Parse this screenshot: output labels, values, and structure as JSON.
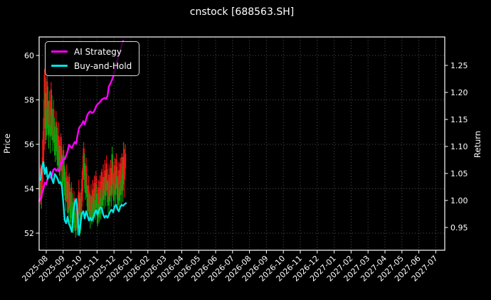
{
  "figure": {
    "title": "cnstock [688563.SH]"
  },
  "legend": {
    "items": [
      {
        "label": "AI Strategy",
        "color": "#ff00ff"
      },
      {
        "label": "Buy-and-Hold",
        "color": "#00e5e5"
      }
    ]
  },
  "axes": {
    "left": {
      "label": "Price",
      "tick_labels": [
        "60",
        "58",
        "56",
        "54",
        "52"
      ],
      "tick_values": [
        60,
        58,
        56,
        54,
        52
      ]
    },
    "right": {
      "label": "Return",
      "tick_labels": [
        "1.25",
        "1.20",
        "1.15",
        "1.10",
        "1.05",
        "1.00",
        "0.95"
      ],
      "tick_values": [
        1.25,
        1.2,
        1.15,
        1.1,
        1.05,
        1.0,
        0.95
      ]
    },
    "bottom": {
      "tick_labels": [
        "2025-08",
        "2025-09",
        "2025-10",
        "2025-11",
        "2025-12",
        "2026-01",
        "2026-02",
        "2026-03",
        "2026-04",
        "2026-05",
        "2026-06",
        "2026-07",
        "2026-08",
        "2026-09",
        "2026-10",
        "2026-11",
        "2026-12",
        "2027-01",
        "2027-02",
        "2027-03",
        "2027-04",
        "2027-05",
        "2027-06",
        "2027-07"
      ]
    }
  },
  "chart_data": {
    "type": "candlestick+line",
    "title": "cnstock [688563.SH]",
    "price_axis": {
      "label": "Price",
      "range": [
        51.2,
        60.85
      ],
      "ticks": [
        52,
        54,
        56,
        58,
        60
      ]
    },
    "return_axis": {
      "label": "Return",
      "range": [
        0.918,
        1.309
      ],
      "ticks": [
        0.95,
        1.0,
        1.05,
        1.1,
        1.15,
        1.2,
        1.25
      ]
    },
    "x_axis": {
      "tick_labels": [
        "2025-08",
        "2025-09",
        "2025-10",
        "2025-11",
        "2025-12",
        "2026-01",
        "2026-02",
        "2026-03",
        "2026-04",
        "2026-05",
        "2026-06",
        "2026-07",
        "2026-08",
        "2026-09",
        "2026-10",
        "2026-11",
        "2026-12",
        "2027-01",
        "2027-02",
        "2027-03",
        "2027-04",
        "2027-05",
        "2027-06",
        "2027-07"
      ],
      "data_span_note": "price/return data covers only 2025-07 through 2025-12; rest of axis is empty"
    },
    "colors": {
      "up_candle": "#f01616",
      "down_candle": "#0ca50c",
      "grid": "#4f4f4f",
      "spine": "#ffffff",
      "text": "#ffffff"
    },
    "candles": {
      "x_start_tick": -0.336,
      "x_step_tick": 0.04808,
      "bars_format": [
        "high",
        "low",
        "up(r)/down(g)"
      ],
      "bars": [
        [
          55.1,
          53.3,
          "r"
        ],
        [
          54.6,
          53.1,
          "g"
        ],
        [
          55.4,
          53.6,
          "r"
        ],
        [
          56.6,
          54.3,
          "r"
        ],
        [
          58.0,
          55.2,
          "r"
        ],
        [
          59.4,
          56.8,
          "r"
        ],
        [
          59.0,
          56.0,
          "g"
        ],
        [
          58.3,
          56.2,
          "g"
        ],
        [
          59.2,
          57.0,
          "r"
        ],
        [
          58.6,
          56.4,
          "g"
        ],
        [
          57.8,
          55.8,
          "g"
        ],
        [
          58.4,
          56.5,
          "r"
        ],
        [
          57.6,
          55.6,
          "g"
        ],
        [
          58.8,
          56.8,
          "r"
        ],
        [
          58.2,
          56.2,
          "g"
        ],
        [
          57.4,
          55.7,
          "g"
        ],
        [
          58.0,
          56.1,
          "r"
        ],
        [
          57.2,
          55.5,
          "g"
        ],
        [
          56.8,
          55.2,
          "g"
        ],
        [
          57.5,
          55.8,
          "r"
        ],
        [
          56.9,
          55.3,
          "g"
        ],
        [
          56.4,
          54.9,
          "g"
        ],
        [
          57.0,
          55.2,
          "r"
        ],
        [
          56.2,
          54.6,
          "g"
        ],
        [
          55.8,
          54.3,
          "g"
        ],
        [
          56.5,
          54.8,
          "r"
        ],
        [
          55.9,
          54.2,
          "g"
        ],
        [
          55.3,
          53.8,
          "g"
        ],
        [
          56.0,
          54.4,
          "r"
        ],
        [
          55.5,
          53.9,
          "g"
        ],
        [
          54.9,
          53.5,
          "g"
        ],
        [
          54.4,
          53.0,
          "g"
        ],
        [
          55.1,
          53.4,
          "r"
        ],
        [
          54.6,
          52.9,
          "g"
        ],
        [
          54.0,
          52.6,
          "g"
        ],
        [
          54.7,
          53.0,
          "r"
        ],
        [
          54.2,
          52.7,
          "g"
        ],
        [
          53.6,
          52.3,
          "g"
        ],
        [
          54.3,
          52.8,
          "r"
        ],
        [
          53.8,
          52.4,
          "g"
        ],
        [
          53.2,
          52.0,
          "g"
        ],
        [
          53.9,
          52.5,
          "r"
        ],
        [
          53.4,
          52.1,
          "g"
        ],
        [
          52.9,
          51.8,
          "g"
        ],
        [
          53.5,
          52.2,
          "r"
        ],
        [
          53.0,
          51.9,
          "g"
        ],
        [
          53.7,
          52.3,
          "r"
        ],
        [
          54.4,
          52.9,
          "r"
        ],
        [
          53.8,
          52.5,
          "g"
        ],
        [
          53.3,
          52.0,
          "g"
        ],
        [
          54.0,
          52.6,
          "r"
        ],
        [
          54.8,
          53.2,
          "r"
        ],
        [
          55.5,
          53.9,
          "r"
        ],
        [
          56.1,
          54.4,
          "r"
        ],
        [
          55.6,
          54.0,
          "g"
        ],
        [
          54.9,
          53.5,
          "g"
        ],
        [
          55.4,
          53.8,
          "r"
        ],
        [
          54.7,
          53.2,
          "g"
        ],
        [
          54.1,
          52.8,
          "g"
        ],
        [
          54.6,
          53.0,
          "r"
        ],
        [
          53.9,
          52.6,
          "g"
        ],
        [
          53.4,
          52.2,
          "g"
        ],
        [
          54.2,
          52.7,
          "r"
        ],
        [
          53.7,
          52.4,
          "g"
        ],
        [
          54.4,
          52.9,
          "r"
        ],
        [
          53.8,
          52.5,
          "g"
        ],
        [
          54.6,
          53.1,
          "r"
        ],
        [
          54.0,
          52.6,
          "g"
        ],
        [
          54.8,
          53.3,
          "r"
        ],
        [
          54.2,
          52.8,
          "g"
        ],
        [
          53.6,
          52.3,
          "g"
        ],
        [
          54.4,
          52.9,
          "r"
        ],
        [
          53.8,
          52.5,
          "g"
        ],
        [
          54.6,
          53.0,
          "r"
        ],
        [
          54.0,
          52.6,
          "g"
        ],
        [
          54.9,
          53.4,
          "r"
        ],
        [
          54.3,
          52.9,
          "g"
        ],
        [
          55.1,
          53.5,
          "r"
        ],
        [
          54.5,
          53.1,
          "g"
        ],
        [
          55.3,
          53.7,
          "r"
        ],
        [
          54.7,
          53.2,
          "g"
        ],
        [
          55.5,
          53.9,
          "r"
        ],
        [
          54.9,
          53.4,
          "g"
        ],
        [
          54.3,
          52.9,
          "g"
        ],
        [
          55.1,
          53.5,
          "r"
        ],
        [
          54.5,
          53.0,
          "g"
        ],
        [
          55.3,
          53.7,
          "r"
        ],
        [
          54.7,
          53.2,
          "g"
        ],
        [
          55.9,
          53.8,
          "g"
        ],
        [
          55.2,
          53.6,
          "r"
        ],
        [
          54.6,
          53.1,
          "g"
        ],
        [
          55.4,
          53.8,
          "r"
        ],
        [
          54.8,
          53.3,
          "g"
        ],
        [
          55.6,
          54.0,
          "r"
        ],
        [
          55.0,
          53.5,
          "g"
        ],
        [
          54.4,
          53.0,
          "g"
        ],
        [
          55.2,
          53.6,
          "r"
        ],
        [
          54.6,
          53.1,
          "g"
        ],
        [
          55.4,
          53.8,
          "r"
        ],
        [
          54.8,
          53.3,
          "g"
        ],
        [
          55.6,
          53.9,
          "r"
        ],
        [
          55.0,
          53.4,
          "g"
        ],
        [
          56.1,
          54.2,
          "g"
        ],
        [
          55.8,
          53.6,
          "r"
        ],
        [
          56.0,
          54.6,
          "r"
        ]
      ]
    },
    "series": [
      {
        "name": "AI Strategy",
        "axis": "return",
        "color": "#ff00ff",
        "x_start_tick": -0.42,
        "x_step_tick": 0.084,
        "values": [
          0.999,
          1.003,
          1.013,
          1.022,
          1.033,
          1.03,
          1.04,
          1.045,
          1.042,
          1.046,
          1.057,
          1.059,
          1.055,
          1.058,
          1.054,
          1.07,
          1.068,
          1.079,
          1.076,
          1.083,
          1.091,
          1.103,
          1.1,
          1.097,
          1.103,
          1.108,
          1.105,
          1.121,
          1.134,
          1.138,
          1.141,
          1.147,
          1.141,
          1.15,
          1.159,
          1.163,
          1.165,
          1.162,
          1.163,
          1.167,
          1.174,
          1.178,
          1.18,
          1.183,
          1.187,
          1.188,
          1.19,
          1.188,
          1.193,
          1.211,
          1.216,
          1.222,
          1.229,
          1.24,
          1.253,
          1.259,
          1.27,
          1.279,
          1.288,
          1.295
        ]
      },
      {
        "name": "Buy-and-Hold",
        "axis": "return",
        "color": "#00e5e5",
        "x_start_tick": -0.336,
        "x_step_tick": 0.084,
        "values": [
          1.038,
          1.062,
          1.071,
          1.049,
          1.061,
          1.04,
          1.046,
          1.053,
          1.04,
          1.032,
          1.049,
          1.045,
          1.04,
          1.032,
          1.034,
          1.026,
          0.996,
          0.963,
          0.958,
          0.97,
          0.957,
          0.95,
          0.942,
          0.976,
          0.996,
          1.003,
          0.976,
          0.936,
          0.955,
          0.976,
          0.98,
          0.967,
          0.98,
          0.972,
          0.963,
          0.968,
          0.963,
          0.968,
          0.976,
          0.982,
          0.974,
          0.982,
          0.987,
          0.986,
          0.974,
          0.968,
          0.972,
          0.968,
          0.974,
          0.98,
          0.983,
          0.978,
          0.988,
          0.992,
          0.984,
          0.98,
          0.988,
          0.992,
          0.99,
          0.993,
          0.995
        ]
      }
    ],
    "legend_position": "upper left",
    "grid": "dotted, on price (horizontal) and month (vertical) ticks",
    "background": "#000000"
  }
}
